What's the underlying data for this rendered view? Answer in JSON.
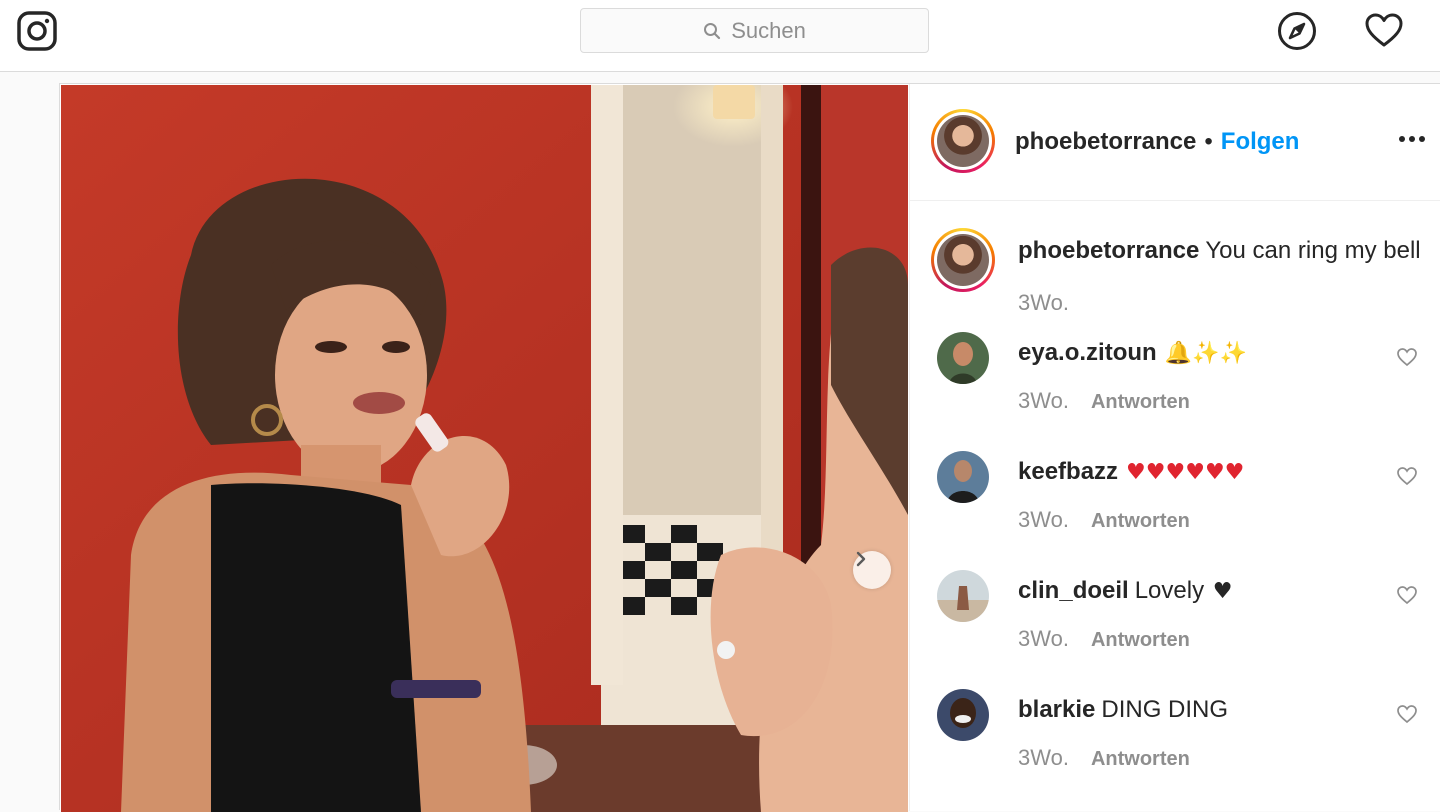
{
  "nav": {
    "search_placeholder": "Suchen",
    "icons": [
      "instagram-logo-icon",
      "search-icon",
      "compass-icon",
      "heart-icon"
    ]
  },
  "post": {
    "author": "phoebetorrance",
    "separator": "•",
    "follow_label": "Folgen",
    "more_icon": "more-horizontal-icon",
    "next_icon": "chevron-right-icon"
  },
  "caption": {
    "user": "phoebetorrance",
    "text": "You can ring my bell",
    "time": "3Wo."
  },
  "comments": [
    {
      "user": "eya.o.zitoun",
      "text": "",
      "emoji": "🔔✨✨",
      "emoji_color": "#e8b31e",
      "time": "3Wo.",
      "reply": "Antworten"
    },
    {
      "user": "keefbazz",
      "text": "",
      "emoji": "♥♥♥♥♥♥",
      "emoji_color": "#e0242f",
      "time": "3Wo.",
      "reply": "Antworten"
    },
    {
      "user": "clin_doeil",
      "text": "Lovely",
      "emoji": "♥",
      "emoji_color": "#262626",
      "time": "3Wo.",
      "reply": "Antworten"
    },
    {
      "user": "blarkie",
      "text": "DING DING",
      "emoji": "",
      "emoji_color": "#262626",
      "time": "3Wo.",
      "reply": "Antworten"
    }
  ],
  "colors": {
    "link": "#0095f6",
    "text": "#262626",
    "muted": "#8e8e8e",
    "border": "#dbdbdb"
  }
}
